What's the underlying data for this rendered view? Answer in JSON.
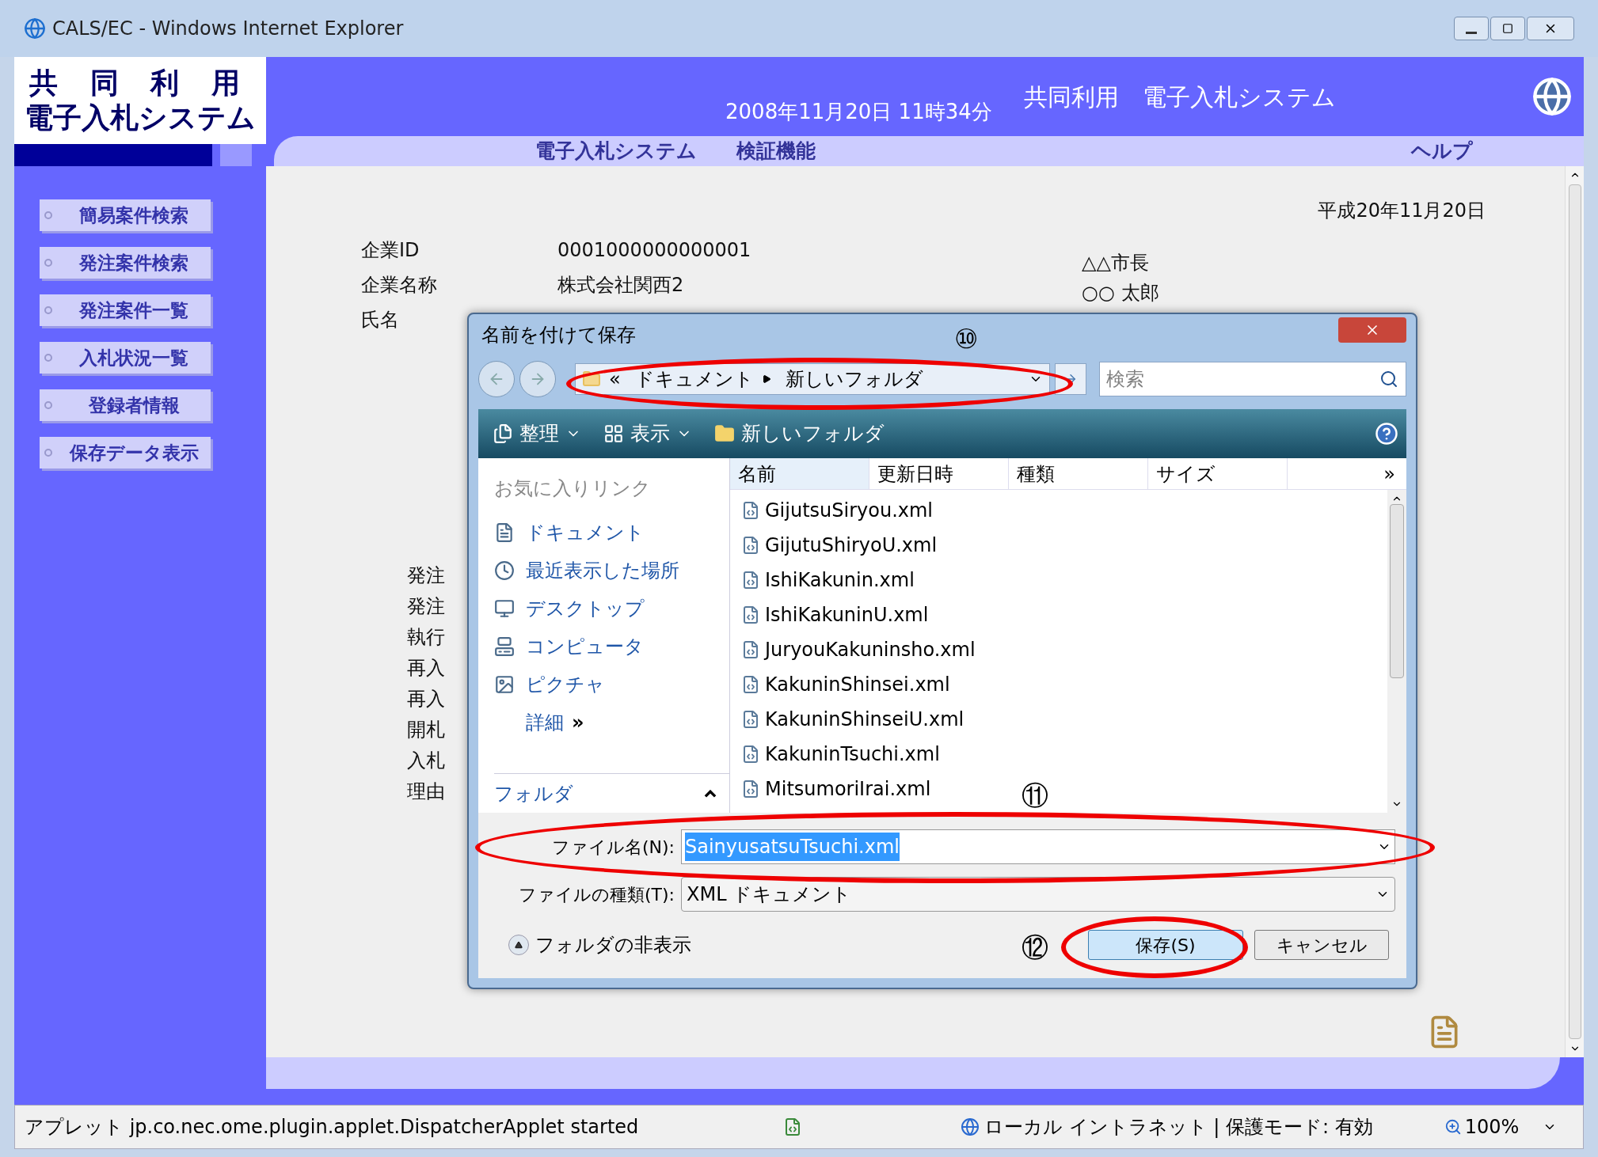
{
  "window": {
    "title": "CALS/EC - Windows Internet Explorer"
  },
  "header": {
    "logo_line1": "共 同 利 用",
    "logo_line2": "電子入札システム",
    "datetime": "2008年11月20日 11時34分",
    "system_name": "共同利用　電子入札システム"
  },
  "nav": [
    {
      "label": "電子入札システム"
    },
    {
      "label": "検証機能"
    },
    {
      "label": "ヘルプ"
    }
  ],
  "sidebar": {
    "items": [
      {
        "label": "簡易案件検索"
      },
      {
        "label": "発注案件検索"
      },
      {
        "label": "発注案件一覧"
      },
      {
        "label": "入札状況一覧"
      },
      {
        "label": "登録者情報"
      },
      {
        "label": "保存データ表示"
      }
    ]
  },
  "page": {
    "date": "平成20年11月20日",
    "fields": [
      {
        "label": "企業ID",
        "value": "0001000000000001"
      },
      {
        "label": "企業名称",
        "value": "株式会社関西2"
      },
      {
        "label": "氏名"
      }
    ],
    "recipient": [
      "△△市長",
      "○○ 太郎"
    ],
    "partial_labels": [
      "発注",
      "発注",
      "執行",
      "再入",
      "再入",
      "開札",
      "入札",
      "理由"
    ]
  },
  "dialog": {
    "title": "名前を付けて保存",
    "breadcrumb_prefix": "«",
    "breadcrumb": [
      "ドキュメント",
      "新しいフォルダ"
    ],
    "search_placeholder": "検索",
    "toolbar": [
      {
        "label": "整理",
        "kind": "menu"
      },
      {
        "label": "表示",
        "kind": "view"
      },
      {
        "label": "新しいフォルダ",
        "kind": "folder"
      }
    ],
    "favorites_heading": "お気に入りリンク",
    "favorites": [
      {
        "label": "ドキュメント",
        "kind": "documents"
      },
      {
        "label": "最近表示した場所",
        "kind": "recent"
      },
      {
        "label": "デスクトップ",
        "kind": "desktop"
      },
      {
        "label": "コンピュータ",
        "kind": "computer"
      },
      {
        "label": "ピクチャ",
        "kind": "pictures"
      }
    ],
    "more": "詳細",
    "more_arrow": "»",
    "folders": "フォルダ",
    "columns": [
      "名前",
      "更新日時",
      "種類",
      "サイズ"
    ],
    "columns_more": "»",
    "files": [
      "GijutsuSiryou.xml",
      "GijutuShiryoU.xml",
      "IshiKakunin.xml",
      "IshiKakuninU.xml",
      "JuryouKakuninsho.xml",
      "KakuninShinsei.xml",
      "KakuninShinseiU.xml",
      "KakuninTsuchi.xml",
      "MitsumoriIrai.xml"
    ],
    "filename_label": "ファイル名(N):",
    "filename": "SainyusatsuTsuchi.xml",
    "filename_selected": true,
    "filetype_label": "ファイルの種類(T):",
    "filetype": "XML ドキュメント",
    "hide_folders": "フォルダの非表示",
    "save": "保存(S)",
    "cancel": "キャンセル"
  },
  "annotations": [
    {
      "label": "⑩"
    },
    {
      "label": "⑪"
    },
    {
      "label": "⑫"
    }
  ],
  "status_bar": {
    "message": "アプレット jp.co.nec.ome.plugin.applet.DispatcherApplet started",
    "zone": "ローカル イントラネット | 保護モード: 有効",
    "zoom": "100%"
  }
}
